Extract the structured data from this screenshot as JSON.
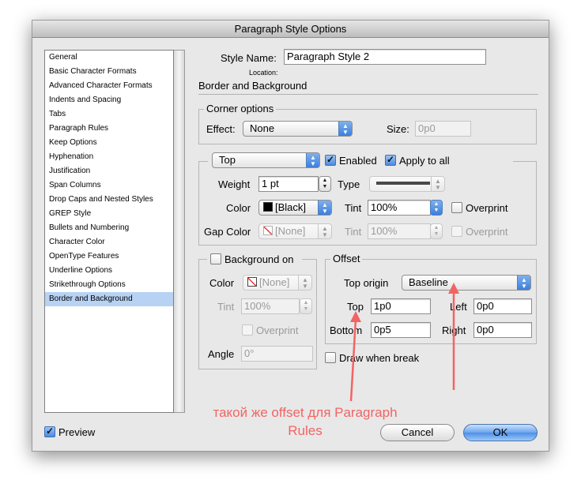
{
  "window": {
    "title": "Paragraph Style Options"
  },
  "sidebar": {
    "items": [
      {
        "label": "General"
      },
      {
        "label": "Basic Character Formats"
      },
      {
        "label": "Advanced Character Formats"
      },
      {
        "label": "Indents and Spacing"
      },
      {
        "label": "Tabs"
      },
      {
        "label": "Paragraph Rules"
      },
      {
        "label": "Keep Options"
      },
      {
        "label": "Hyphenation"
      },
      {
        "label": "Justification"
      },
      {
        "label": "Span Columns"
      },
      {
        "label": "Drop Caps and Nested Styles"
      },
      {
        "label": "GREP Style"
      },
      {
        "label": "Bullets and Numbering"
      },
      {
        "label": "Character Color"
      },
      {
        "label": "OpenType Features"
      },
      {
        "label": "Underline Options"
      },
      {
        "label": "Strikethrough Options"
      },
      {
        "label": "Border and Background"
      }
    ],
    "selected_index": 17
  },
  "header": {
    "style_name_label": "Style Name:",
    "style_name_value": "Paragraph Style 2",
    "location_label": "Location:",
    "section_title": "Border and Background"
  },
  "corner_options": {
    "title": "Corner options",
    "effect_label": "Effect:",
    "effect_value": "None",
    "size_label": "Size:",
    "size_value": "0p0"
  },
  "border": {
    "side_value": "Top",
    "enabled_label": "Enabled",
    "enabled_checked": true,
    "apply_all_label": "Apply to all",
    "apply_all_checked": true,
    "weight_label": "Weight",
    "weight_value": "1 pt",
    "type_label": "Type",
    "color_label": "Color",
    "color_value": "[Black]",
    "tint_label": "Tint",
    "tint_value": "100%",
    "overprint_label": "Overprint",
    "gap_color_label": "Gap Color",
    "gap_color_value": "[None]",
    "gap_tint_label": "Tint",
    "gap_tint_value": "100%",
    "gap_overprint_label": "Overprint"
  },
  "background": {
    "title": "Background on",
    "checked": false,
    "color_label": "Color",
    "color_value": "[None]",
    "tint_label": "Tint",
    "tint_value": "100%",
    "overprint_label": "Overprint",
    "angle_label": "Angle",
    "angle_value": "0°"
  },
  "offset": {
    "title": "Offset",
    "top_origin_label": "Top origin",
    "top_origin_value": "Baseline",
    "top_label": "Top",
    "top_value": "1p0",
    "left_label": "Left",
    "left_value": "0p0",
    "bottom_label": "Bottom",
    "bottom_value": "0p5",
    "right_label": "Right",
    "right_value": "0p0",
    "draw_when_break_label": "Draw when break",
    "draw_when_break_checked": false
  },
  "annotation": {
    "text_line1": "такой же offset для Paragraph",
    "text_line2": "Rules"
  },
  "footer": {
    "preview_label": "Preview",
    "preview_checked": true,
    "cancel_label": "Cancel",
    "ok_label": "OK"
  },
  "colors": {
    "accent": "#4d8ee6",
    "selection": "#b7d2f3",
    "annotation": "#f26464"
  }
}
